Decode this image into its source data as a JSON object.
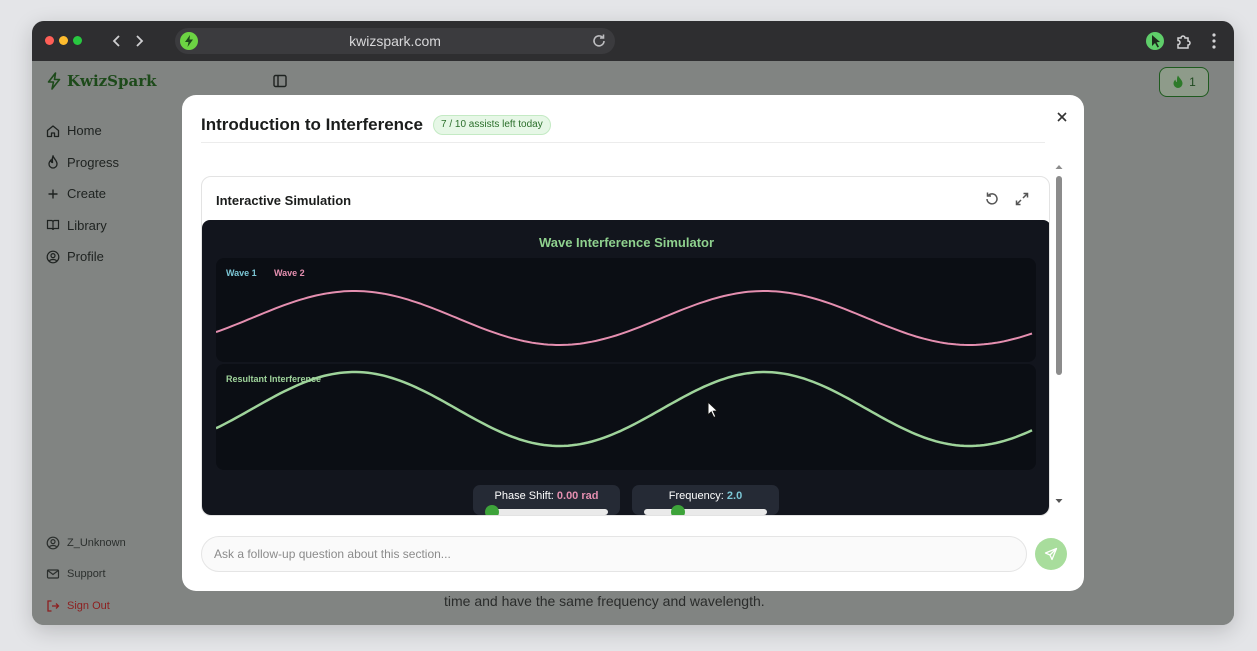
{
  "browser": {
    "url": "kwizspark.com",
    "colors": {
      "close": "#ff5f57",
      "minimize": "#febc2e",
      "maximize": "#28c840"
    }
  },
  "app": {
    "brand": "KwizSpark",
    "nav": [
      {
        "label": "Home",
        "icon": "home-icon"
      },
      {
        "label": "Progress",
        "icon": "flame-icon"
      },
      {
        "label": "Create",
        "icon": "plus-icon"
      },
      {
        "label": "Library",
        "icon": "book-icon"
      },
      {
        "label": "Profile",
        "icon": "user-circle-icon"
      }
    ],
    "nav_bottom": [
      {
        "label": "Z_Unknown",
        "icon": "user-circle-icon"
      },
      {
        "label": "Support",
        "icon": "mail-icon"
      },
      {
        "label": "Sign Out",
        "icon": "logout-icon"
      }
    ],
    "streak_count": "1",
    "background_text": "time and have the same frequency and wavelength."
  },
  "modal": {
    "title": "Introduction to Interference",
    "assist_badge": "7 / 10 assists left today",
    "simulation": {
      "header": "Interactive Simulation",
      "title": "Wave Interference Simulator",
      "legend_wave1": "Wave 1",
      "legend_wave2": "Wave 2",
      "resultant_label": "Resultant Interference",
      "phase_label": "Phase Shift: ",
      "phase_value": "0.00 rad",
      "frequency_label": "Frequency: ",
      "frequency_value": "2.0",
      "colors": {
        "wave1": "#7cc7d6",
        "wave2": "#e58fb0",
        "resultant": "#9fd49b",
        "title": "#8fd18e"
      }
    },
    "followup_placeholder": "Ask a follow-up question about this section..."
  }
}
